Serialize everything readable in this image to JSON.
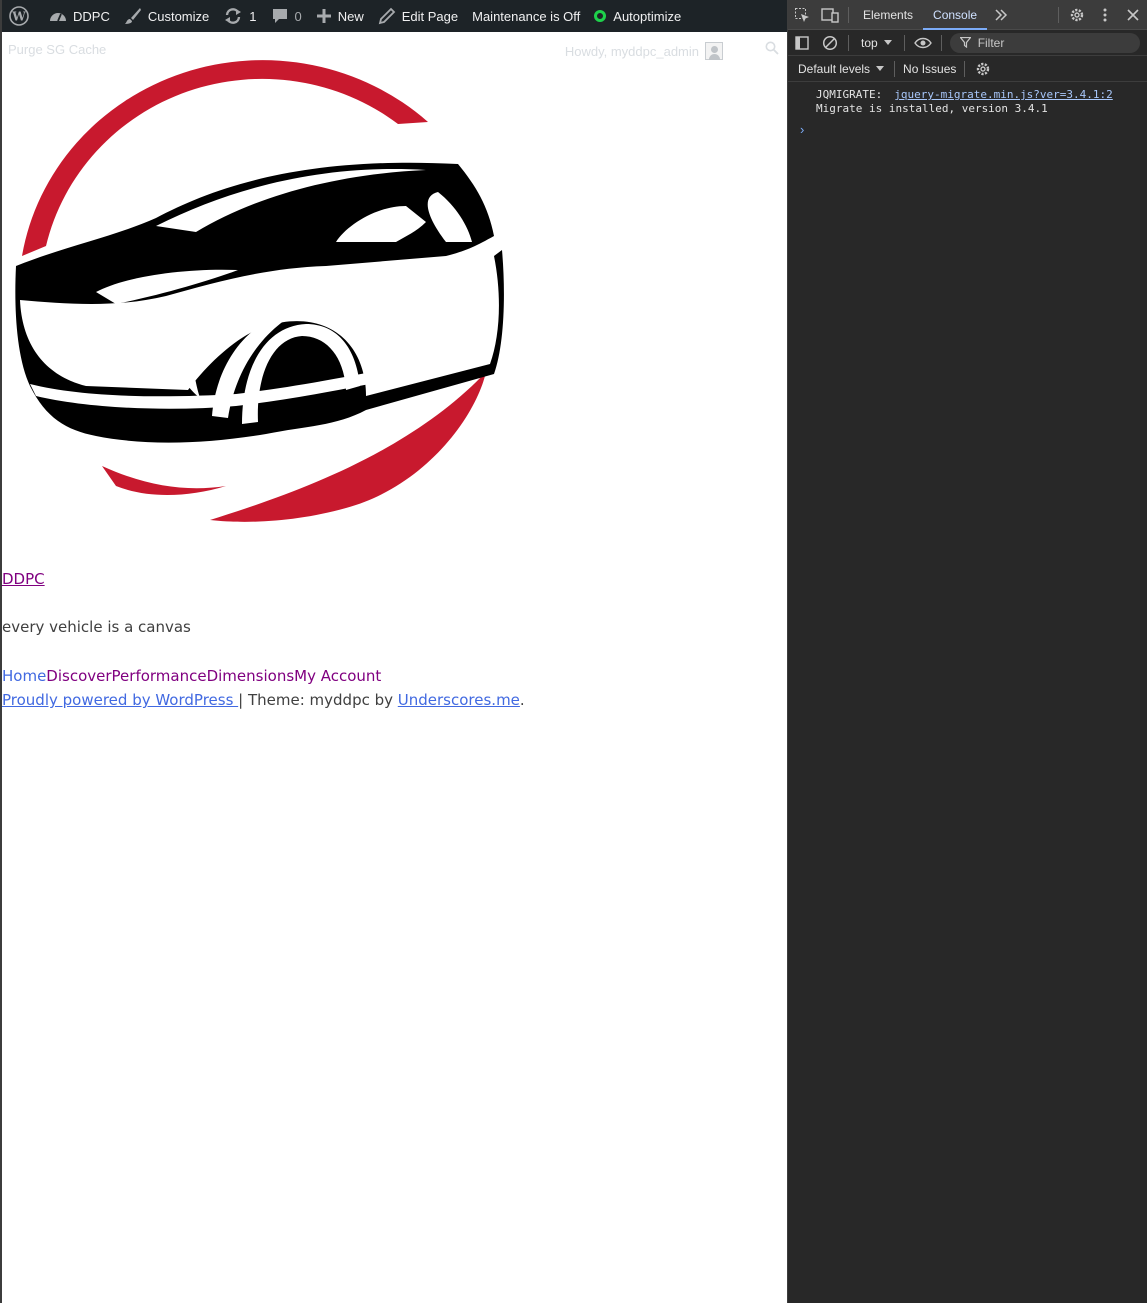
{
  "adminbar": {
    "site_name": "DDPC",
    "customize": "Customize",
    "updates_count": "1",
    "comments_count": "0",
    "new_label": "New",
    "edit_page": "Edit Page",
    "maintenance": "Maintenance is Off",
    "autoptimize": "Autoptimize"
  },
  "subbar": {
    "purge": "Purge SG Cache",
    "howdy": "Howdy, myddpc_admin"
  },
  "site": {
    "title": "DDPC",
    "tagline": "every vehicle is a canvas",
    "nav": [
      {
        "label": "Home",
        "color": "#4169e1"
      },
      {
        "label": "Discover",
        "color": "#800080"
      },
      {
        "label": "Performance",
        "color": "#800080"
      },
      {
        "label": "Dimensions",
        "color": "#800080"
      },
      {
        "label": "My Account",
        "color": "#800080"
      }
    ],
    "footer": {
      "powered": "Proudly powered by WordPress ",
      "theme_text": "| Theme: myddpc by ",
      "theme_link": "Underscores.me",
      "period": "."
    },
    "logo_colors": {
      "red": "#c8192e",
      "black": "#000000"
    }
  },
  "devtools": {
    "tabs": [
      "Elements",
      "Console"
    ],
    "active_tab": "Console",
    "context": "top",
    "filter_placeholder": "Filter",
    "levels": "Default levels",
    "issues": "No Issues",
    "messages": [
      {
        "prefix": "JQMIGRATE:",
        "source": "jquery-migrate.min.js?ver=3.4.1:2",
        "text": "Migrate is installed, version 3.4.1"
      }
    ],
    "prompt": "›"
  }
}
